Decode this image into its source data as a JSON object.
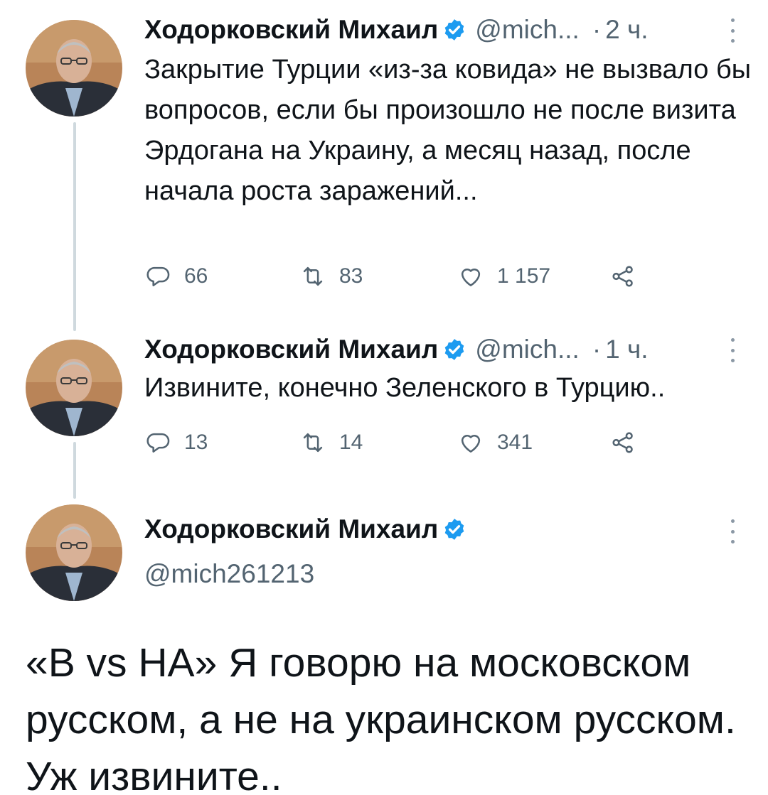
{
  "colors": {
    "text": "#0f1419",
    "secondary": "#536471",
    "verified": "#1d9bf0",
    "thread_line": "#cfd9de"
  },
  "icons": {
    "reply": "reply-icon",
    "retweet": "retweet-icon",
    "like": "heart-icon",
    "share": "share-icon",
    "verified": "verified-badge-icon",
    "more": "more-vertical-icon"
  },
  "tweets": [
    {
      "display_name": "Ходорковский Михаил",
      "handle": "@mich...",
      "dot": "·",
      "time": "2 ч.",
      "text": "Закрытие Турции «из-за ковида» не вызвало бы вопросов, если бы произошло не после визита Эрдогана на Украину, а месяц назад, после начала роста заражений...",
      "replies": "66",
      "retweets": "83",
      "likes": "1 157"
    },
    {
      "display_name": "Ходорковский Михаил",
      "handle": "@mich...",
      "dot": "·",
      "time": "1 ч.",
      "text": "Извините, конечно Зеленского в Турцию..",
      "replies": "13",
      "retweets": "14",
      "likes": "341"
    }
  ],
  "main_tweet": {
    "display_name": "Ходорковский Михаил",
    "handle": "@mich261213",
    "text": "«В vs НА» Я говорю на московском русском, а не на украинском русском. Уж извините.."
  }
}
